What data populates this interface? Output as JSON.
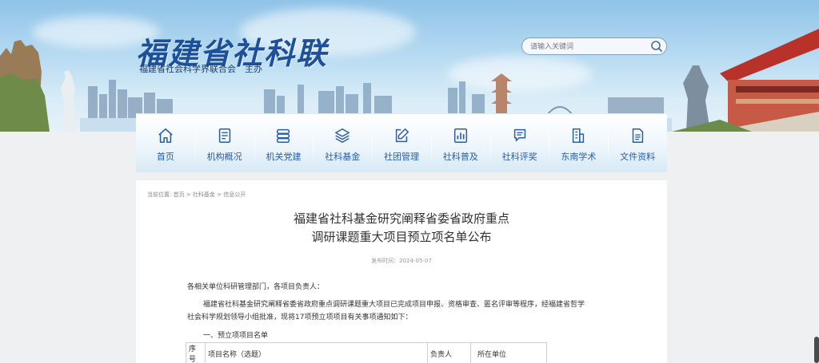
{
  "header": {
    "logo_title": "福建省社科联",
    "logo_subtitle": "福建省社会科学界联合会　主办"
  },
  "search": {
    "placeholder": "请输入关键词",
    "icon": "search-icon"
  },
  "nav": {
    "items": [
      {
        "label": "首页",
        "icon": "home-icon"
      },
      {
        "label": "机构概况",
        "icon": "document-list-icon"
      },
      {
        "label": "机关党建",
        "icon": "database-icon"
      },
      {
        "label": "社科基金",
        "icon": "layers-icon"
      },
      {
        "label": "社团管理",
        "icon": "edit-icon"
      },
      {
        "label": "社科普及",
        "icon": "bar-chart-icon"
      },
      {
        "label": "社科评奖",
        "icon": "chat-icon"
      },
      {
        "label": "东南学术",
        "icon": "building-icon"
      },
      {
        "label": "文件资料",
        "icon": "file-icon"
      }
    ]
  },
  "breadcrumb": {
    "prefix": "当前位置:",
    "items": [
      "首页",
      "社科基金",
      "信息公开"
    ],
    "separator": ">"
  },
  "article": {
    "title_line1": "福建省社科基金研究阐释省委省政府重点",
    "title_line2": "调研课题重大项目预立项名单公布",
    "date": "发布时间：2024-05-07",
    "greeting": "各相关单位科研管理部门，各项目负责人：",
    "body": "福建省社科基金研究阐释省委省政府重点调研课题重大项目已完成项目申报、资格审查、匿名评审等程序，经福建省哲学社会科学规划领导小组批准，现将17项预立项项目有关事项通知如下：",
    "section_heading": "一、预立项项目名单",
    "table": {
      "headers": [
        "序号",
        "项目名称（选题）",
        "负责人",
        "所在单位"
      ]
    }
  },
  "colors": {
    "accent": "#2a5da8",
    "title_blue": "#1d4f9a"
  }
}
